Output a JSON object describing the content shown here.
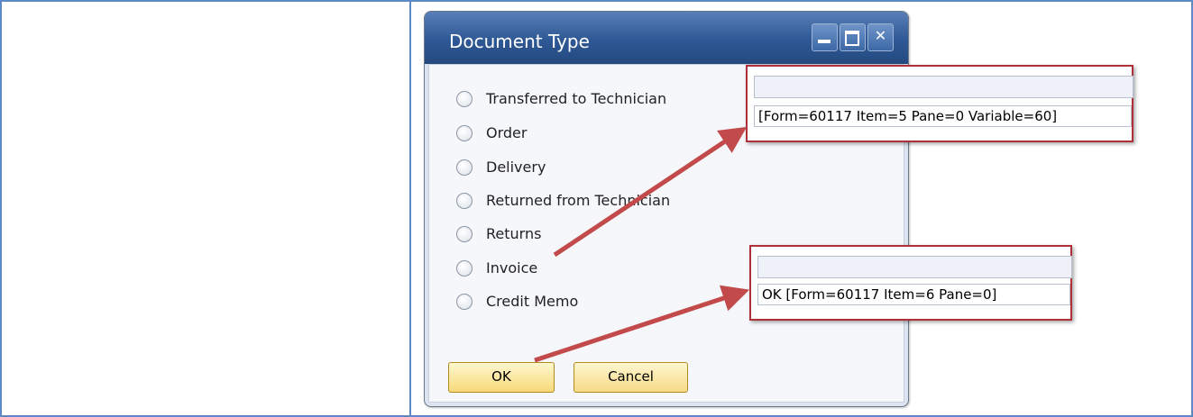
{
  "dialog": {
    "title": "Document Type",
    "options": [
      {
        "label": "Transferred to Technician",
        "selected": false
      },
      {
        "label": "Order",
        "selected": false
      },
      {
        "label": "Delivery",
        "selected": false
      },
      {
        "label": "Returned from Technician",
        "selected": false
      },
      {
        "label": "Returns",
        "selected": false
      },
      {
        "label": "Invoice",
        "selected": false
      },
      {
        "label": "Credit Memo",
        "selected": false
      }
    ],
    "ok_label": "OK",
    "cancel_label": "Cancel"
  },
  "tooltips": [
    {
      "text": "[Form=60117 Item=5 Pane=0 Variable=60]"
    },
    {
      "text": "OK [Form=60117 Item=6 Pane=0]"
    }
  ],
  "colors": {
    "titlebar": "#2e5895",
    "tooltip_border": "#b0303a",
    "arrow": "#c24a4a",
    "button": "#f7d978",
    "frame": "#5b8ac7"
  }
}
